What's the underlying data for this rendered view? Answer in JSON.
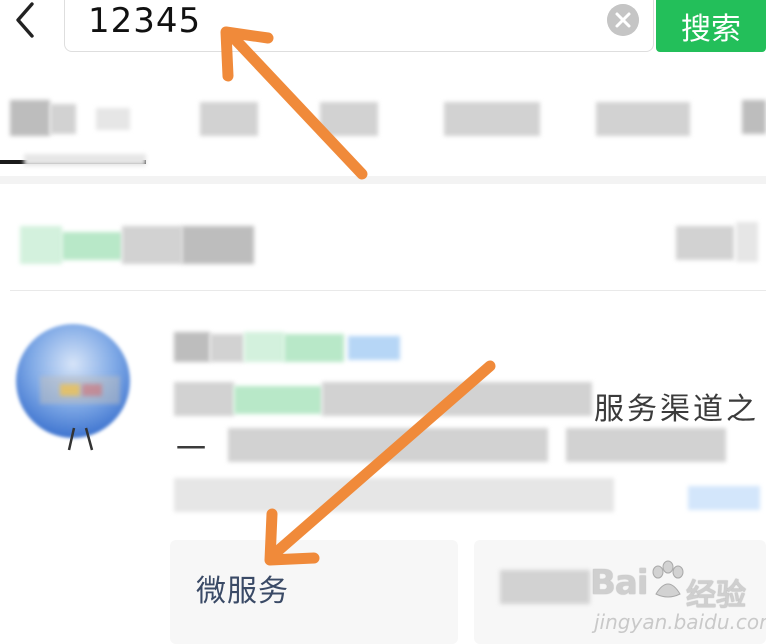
{
  "search": {
    "query": "12345",
    "button_label": "搜索"
  },
  "result": {
    "description_tail_1": "服务渠道之",
    "description_tail_2": "一",
    "service_card_label": "微服务"
  },
  "watermark": {
    "word": "Bai",
    "word2": "经验",
    "url": "jingyan.baidu.com"
  },
  "colors": {
    "search_button": "#23bf5a",
    "arrow": "#f08a3a",
    "tab_underline": "#1a1a1a"
  },
  "icons": {
    "back": "chevron-left-icon",
    "clear": "clear-icon",
    "paw": "paw-icon"
  }
}
